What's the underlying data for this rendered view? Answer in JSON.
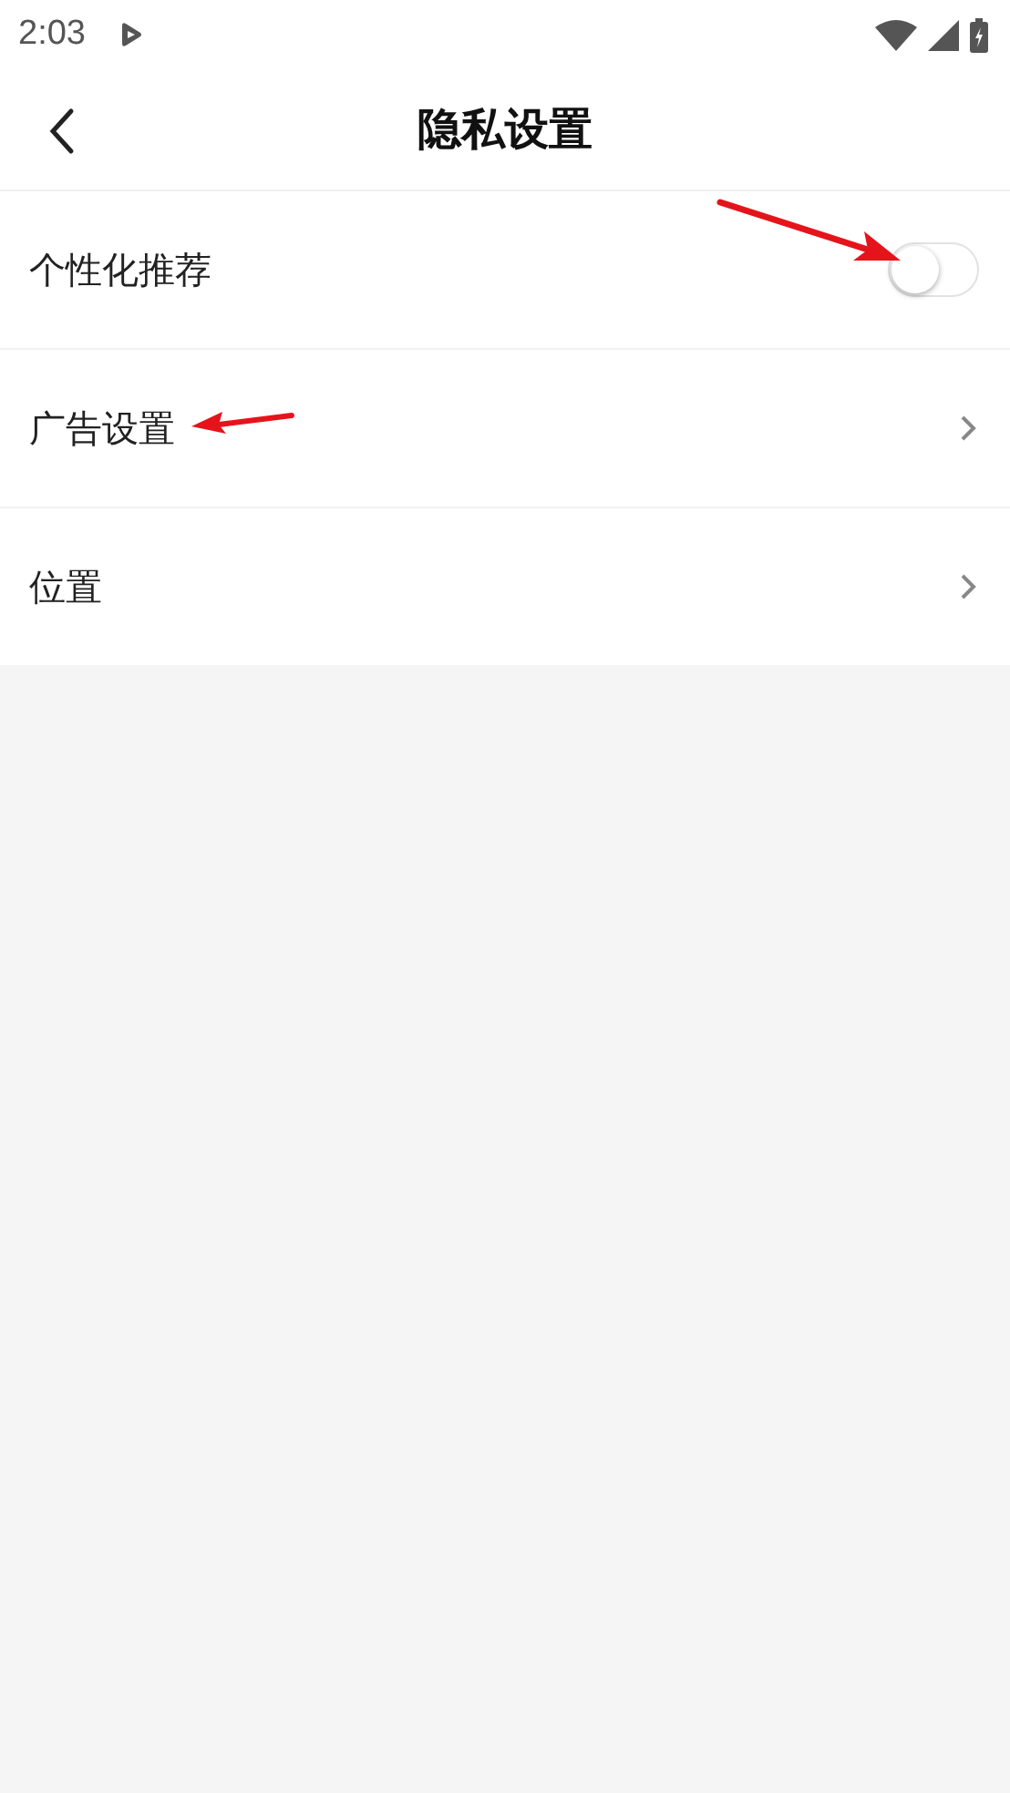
{
  "status_bar": {
    "time": "2:03"
  },
  "header": {
    "title": "隐私设置"
  },
  "items": [
    {
      "kind": "toggle",
      "label": "个性化推荐",
      "on": false,
      "annotated": true
    },
    {
      "kind": "link",
      "label": "广告设置",
      "annotated": true
    },
    {
      "kind": "link",
      "label": "位置",
      "annotated": false
    }
  ]
}
